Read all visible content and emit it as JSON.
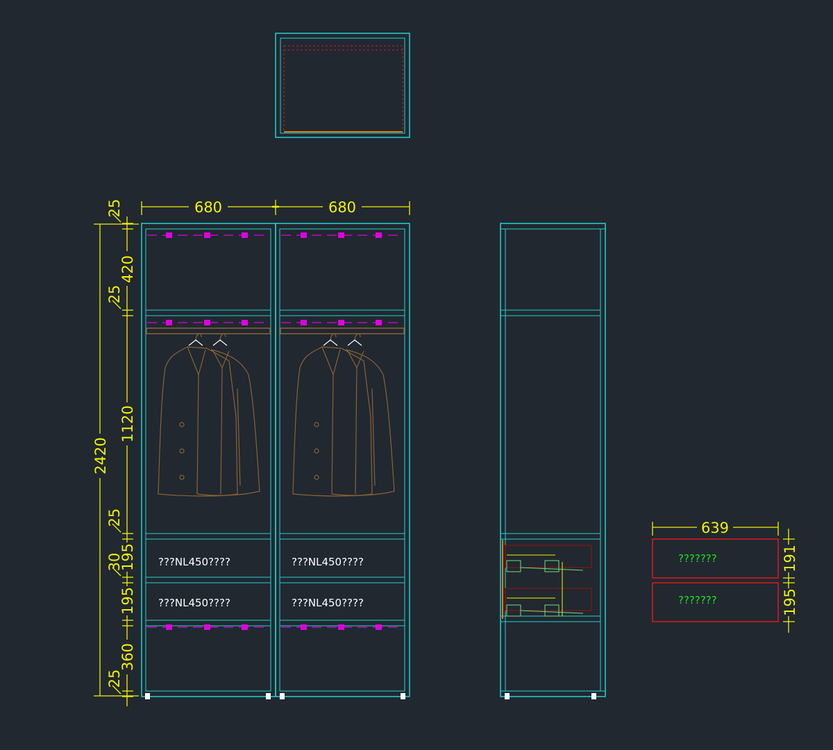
{
  "colors": {
    "background": "#212830",
    "carcass": "#1fd3d3",
    "dimension": "#f2f200",
    "rail": "#e000e0",
    "clothing": "#8a6236",
    "drawer_front": "#e01818",
    "drawer_label": "#22e022",
    "label_text": "#ffffff",
    "hanger": "#ffffff",
    "orange_strip": "#e87a10"
  },
  "front_view": {
    "width_dims": [
      "680",
      "680"
    ],
    "overall_height": "2420",
    "height_dims": [
      "25",
      "420",
      "25",
      "1120",
      "25",
      "195",
      "30",
      "195",
      "360",
      "25"
    ],
    "drawer_labels": [
      "???NL450????",
      "???NL450????",
      "???NL450????",
      "???NL450????"
    ]
  },
  "drawer_detail": {
    "width_dim": "639",
    "height_dims": [
      "191",
      "195"
    ],
    "labels": [
      "???????",
      "???????"
    ]
  }
}
